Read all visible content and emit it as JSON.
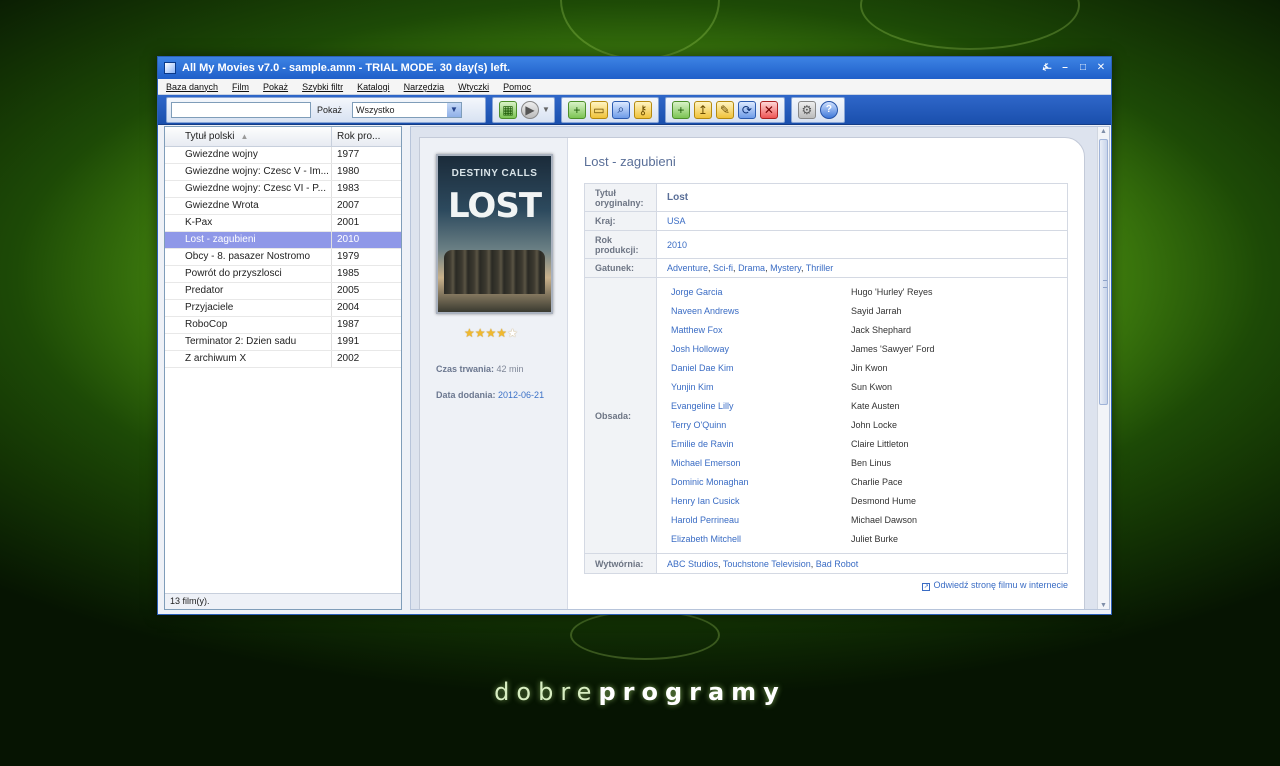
{
  "window": {
    "title": "All My Movies v7.0 - sample.amm - TRIAL MODE. 30 day(s) left.",
    "btn_help": "⍼",
    "btn_min": "–",
    "btn_max": "□",
    "btn_close": "✕"
  },
  "menu": [
    "Baza danych",
    "Film",
    "Pokaż",
    "Szybki filtr",
    "Katalogi",
    "Narzędzia",
    "Wtyczki",
    "Pomoc"
  ],
  "toolbar": {
    "search_value": "",
    "show_label": "Pokaż",
    "show_value": "Wszystko"
  },
  "list": {
    "col_title": "Tytuł polski",
    "col_year": "Rok pro...",
    "rows": [
      {
        "title": "Gwiezdne wojny",
        "year": "1977"
      },
      {
        "title": "Gwiezdne wojny: Czesc V - Im...",
        "year": "1980"
      },
      {
        "title": "Gwiezdne wojny: Czesc VI - P...",
        "year": "1983"
      },
      {
        "title": "Gwiezdne Wrota",
        "year": "2007"
      },
      {
        "title": "K-Pax",
        "year": "2001"
      },
      {
        "title": "Lost - zagubieni",
        "year": "2010"
      },
      {
        "title": "Obcy - 8. pasazer Nostromo",
        "year": "1979"
      },
      {
        "title": "Powrót do przyszlosci",
        "year": "1985"
      },
      {
        "title": "Predator",
        "year": "2005"
      },
      {
        "title": "Przyjaciele",
        "year": "2004"
      },
      {
        "title": "RoboCop",
        "year": "1987"
      },
      {
        "title": "Terminator 2: Dzien sadu",
        "year": "1991"
      },
      {
        "title": "Z archiwum X",
        "year": "2002"
      }
    ],
    "selected_index": 5,
    "status": "13 film(y)."
  },
  "detail": {
    "poster_tagline": "DESTINY CALLS",
    "poster_logo": "LOST",
    "rating": 4,
    "rating_max": 5,
    "duration_label": "Czas trwania:",
    "duration_value": "42 min",
    "added_label": "Data dodania:",
    "added_value": "2012-06-21",
    "title": "Lost - zagubieni",
    "original_title_label": "Tytuł oryginalny:",
    "original_title": "Lost",
    "country_label": "Kraj:",
    "country": "USA",
    "year_label": "Rok produkcji:",
    "year": "2010",
    "genre_label": "Gatunek:",
    "genres": [
      "Adventure",
      "Sci-fi",
      "Drama",
      "Mystery",
      "Thriller"
    ],
    "cast_label": "Obsada:",
    "cast": [
      {
        "actor": "Jorge Garcia",
        "role": "Hugo 'Hurley' Reyes"
      },
      {
        "actor": "Naveen Andrews",
        "role": "Sayid Jarrah"
      },
      {
        "actor": "Matthew Fox",
        "role": "Jack Shephard"
      },
      {
        "actor": "Josh Holloway",
        "role": "James 'Sawyer' Ford"
      },
      {
        "actor": "Daniel Dae Kim",
        "role": "Jin Kwon"
      },
      {
        "actor": "Yunjin Kim",
        "role": "Sun Kwon"
      },
      {
        "actor": "Evangeline Lilly",
        "role": "Kate Austen"
      },
      {
        "actor": "Terry O'Quinn",
        "role": "John Locke"
      },
      {
        "actor": "Emilie de Ravin",
        "role": "Claire Littleton"
      },
      {
        "actor": "Michael Emerson",
        "role": "Ben Linus"
      },
      {
        "actor": "Dominic Monaghan",
        "role": "Charlie Pace"
      },
      {
        "actor": "Henry Ian Cusick",
        "role": "Desmond Hume"
      },
      {
        "actor": "Harold Perrineau",
        "role": "Michael Dawson"
      },
      {
        "actor": "Elizabeth Mitchell",
        "role": "Juliet Burke"
      }
    ],
    "studio_label": "Wytwórnia:",
    "studios": [
      "ABC Studios",
      "Touchstone Television",
      "Bad Robot"
    ],
    "visit_link": "Odwiedź stronę filmu w internecie"
  },
  "brand": {
    "light": "dobre",
    "bold": "programy"
  },
  "colors": {
    "selection": "#8f98e8",
    "link": "#3a6cc4",
    "titlebar": "#1f5fc9",
    "toolbar": "#1a4fad"
  }
}
